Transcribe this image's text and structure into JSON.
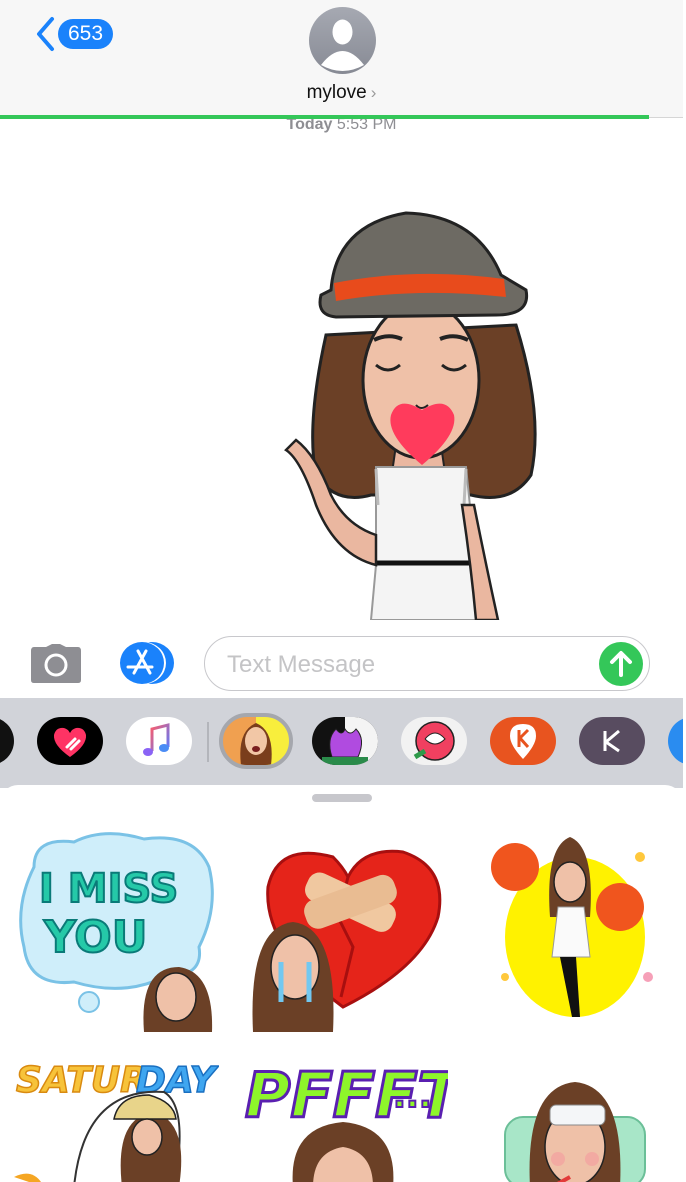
{
  "header": {
    "back_badge_count": "653",
    "contact_name": "mylove",
    "contact_chevron": "›",
    "send_progress_percent": 95
  },
  "thread": {
    "timestamp_day": "Today",
    "timestamp_time": "5:53 PM",
    "messages": [
      {
        "type": "sticker",
        "description": "Bitmoji avatar in grey fedora with red band blowing a heart kiss and waving"
      }
    ]
  },
  "input_bar": {
    "camera_icon": "camera-icon",
    "appstore_icon": "appstore-icon",
    "placeholder": "Text Message",
    "send_icon": "arrow-up-icon"
  },
  "app_drawer": {
    "apps": [
      {
        "name": "partial-app",
        "icon": "app-icon"
      },
      {
        "name": "digital-touch",
        "icon": "heart-touch-icon"
      },
      {
        "name": "music",
        "icon": "music-note-icon"
      },
      {
        "name": "face-app",
        "icon": "face-icon",
        "selected": true
      },
      {
        "name": "coloring-flower",
        "icon": "flower-coloring-icon"
      },
      {
        "name": "coloring-rose",
        "icon": "rose-coloring-icon"
      },
      {
        "name": "klook",
        "icon": "k-pin-icon"
      },
      {
        "name": "keep",
        "icon": "k-letter-icon"
      },
      {
        "name": "partial-blue-app",
        "icon": "app-icon"
      }
    ]
  },
  "stickers": [
    {
      "label": "I MISS YOU"
    },
    {
      "label": "heartbroken crying"
    },
    {
      "label": "cheerleader pom poms"
    },
    {
      "label": "SATURDAY"
    },
    {
      "label": "PFFFT..."
    },
    {
      "label": "sick with thermometer"
    }
  ],
  "colors": {
    "accent_blue": "#1a82fb",
    "send_green": "#34c759",
    "drawer_bg": "#d1d3d9"
  }
}
